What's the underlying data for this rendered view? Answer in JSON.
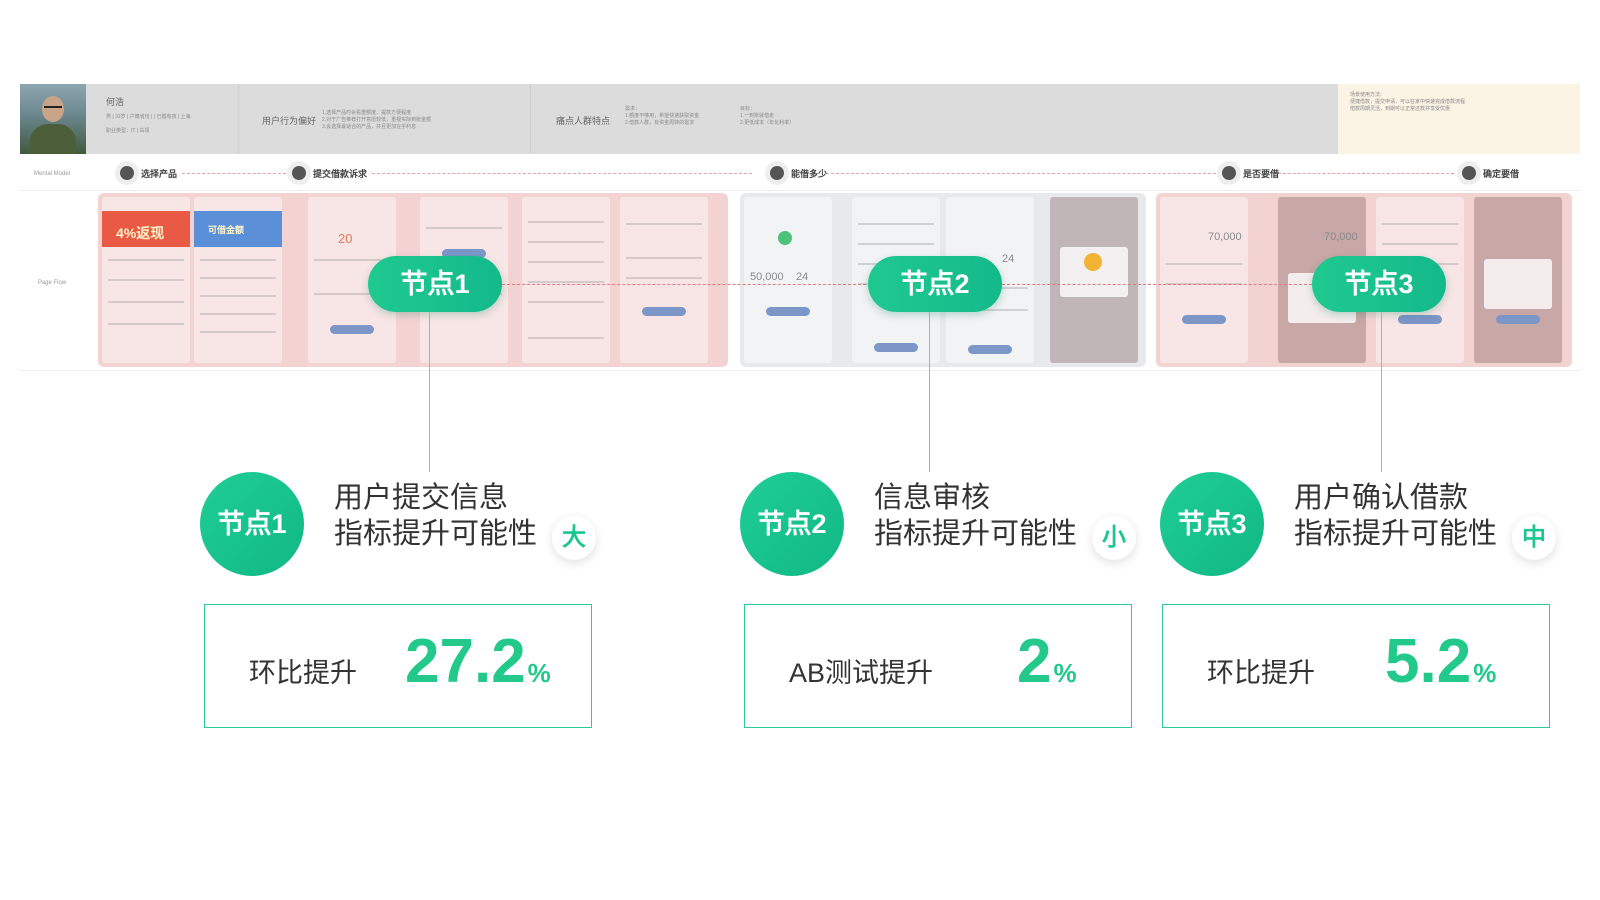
{
  "persona": {
    "name": "何浩",
    "meta": "男 | 32岁 | 户籍省份 | | 已婚有孩 | 上海",
    "meta2": "职业类型：IT | 白领",
    "behavior_title": "用户行为偏好",
    "behavior_text": "1.选择产品时会看重额度、提款方便程度\n2.对于广告推荐打开意愿较低，重视实际到账金额\n3.会选择最适合的产品，并且更加在乎利息",
    "pain_title": "痛点人群特点",
    "pain_text": "需求：\n1.额度不够用，希望快速获取资金\n2.借款人群，有资金周转的需求",
    "goal_text": "目标：\n1.一到账就借走\n2.更低成本（年化利率）",
    "note_text": "场景使用方法：\n便捷借款，提交申请，可以在家中快速完成借款流程\n借款周期灵活，到期可以正常还款并享受优惠"
  },
  "row_labels": {
    "mental_model": "Mental Model",
    "page_flow": "Page Flow"
  },
  "mental_model": [
    {
      "label": "选择产品"
    },
    {
      "label": "提交借款诉求"
    },
    {
      "label": "能借多少"
    },
    {
      "label": "是否要借"
    },
    {
      "label": "确定要借"
    }
  ],
  "flow_screens": {
    "promo1": "4%返现",
    "promo2": "可借金额",
    "amount1": "20",
    "amount2": "50,000",
    "amount3": "24",
    "amount4": "24",
    "amount5": "70,000",
    "amount6": "70,000"
  },
  "nodes": [
    {
      "pill": "节点1",
      "circle": "节点1",
      "line1": "用户提交信息",
      "line2": "指标提升可能性",
      "badge": "大",
      "metric_label": "环比提升",
      "metric_value": "27.2",
      "metric_unit": "%"
    },
    {
      "pill": "节点2",
      "circle": "节点2",
      "line1": "信息审核",
      "line2": "指标提升可能性",
      "badge": "小",
      "metric_label": "AB测试提升",
      "metric_value": "2",
      "metric_unit": "%"
    },
    {
      "pill": "节点3",
      "circle": "节点3",
      "line1": "用户确认借款",
      "line2": "指标提升可能性",
      "badge": "中",
      "metric_label": "环比提升",
      "metric_value": "5.2",
      "metric_unit": "%"
    }
  ],
  "colors": {
    "accent": "#1dc58f",
    "flow_pink": "#f3d2d2",
    "flow_gray": "#e7e9ec",
    "dashed_red": "#e27a7a"
  }
}
